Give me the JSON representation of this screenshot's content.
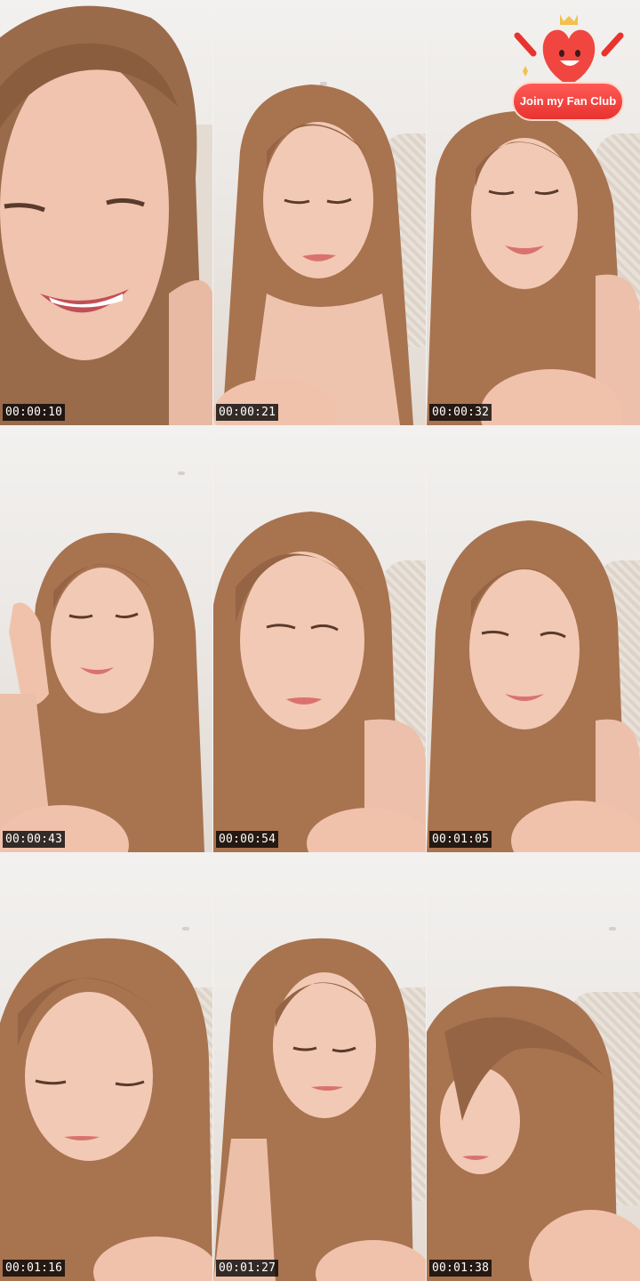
{
  "frames": [
    {
      "timestamp": "00:00:10"
    },
    {
      "timestamp": "00:00:21"
    },
    {
      "timestamp": "00:00:32"
    },
    {
      "timestamp": "00:00:43"
    },
    {
      "timestamp": "00:00:54"
    },
    {
      "timestamp": "00:01:05"
    },
    {
      "timestamp": "00:01:16"
    },
    {
      "timestamp": "00:01:27"
    },
    {
      "timestamp": "00:01:38"
    }
  ],
  "overlay": {
    "fan_club_label": "Join my Fan Club",
    "icon": "heart-mascot-icon",
    "accent": "#e8332f"
  },
  "colors": {
    "hair": "#a8734f",
    "skin": "#f2c9b4",
    "lips": "#d9726e",
    "timestamp_bg": "#000000"
  }
}
